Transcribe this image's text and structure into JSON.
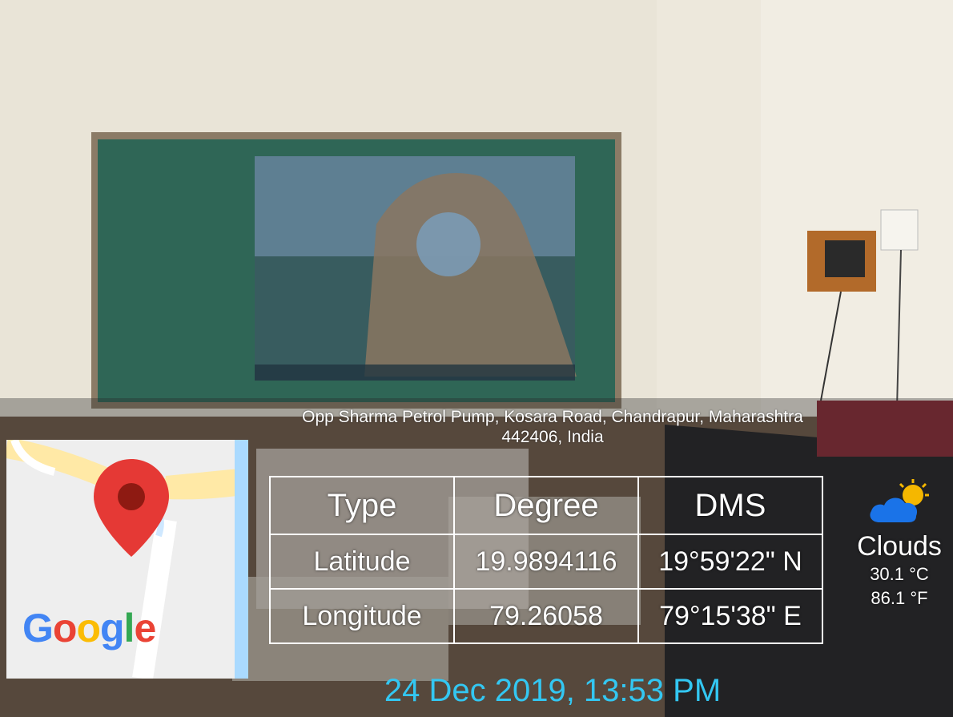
{
  "address": {
    "line1": "Opp Sharma Petrol Pump, Kosara Road, Chandrapur, Maharashtra",
    "line2": "442406, India"
  },
  "map": {
    "logo_text": "Google",
    "pin_icon": "map-pin-icon",
    "logo_colors": [
      "#4285F4",
      "#EA4335",
      "#FBBC05",
      "#4285F4",
      "#34A853",
      "#EA4335"
    ]
  },
  "table": {
    "headers": [
      "Type",
      "Degree",
      "DMS"
    ],
    "rows": [
      [
        "Latitude",
        "19.9894116",
        "19°59'22\" N"
      ],
      [
        "Longitude",
        "79.26058",
        "79°15'38\" E"
      ]
    ]
  },
  "weather": {
    "icon": "partly-cloudy-icon",
    "description": "Clouds",
    "temp_c": "30.1 °C",
    "temp_f": "86.1 °F"
  },
  "datetime": "24 Dec 2019, 13:53 PM",
  "colors": {
    "datetime": "#33c7f2",
    "cloud": "#1a73e8",
    "sun": "#f5b700",
    "pin": "#e53935"
  }
}
